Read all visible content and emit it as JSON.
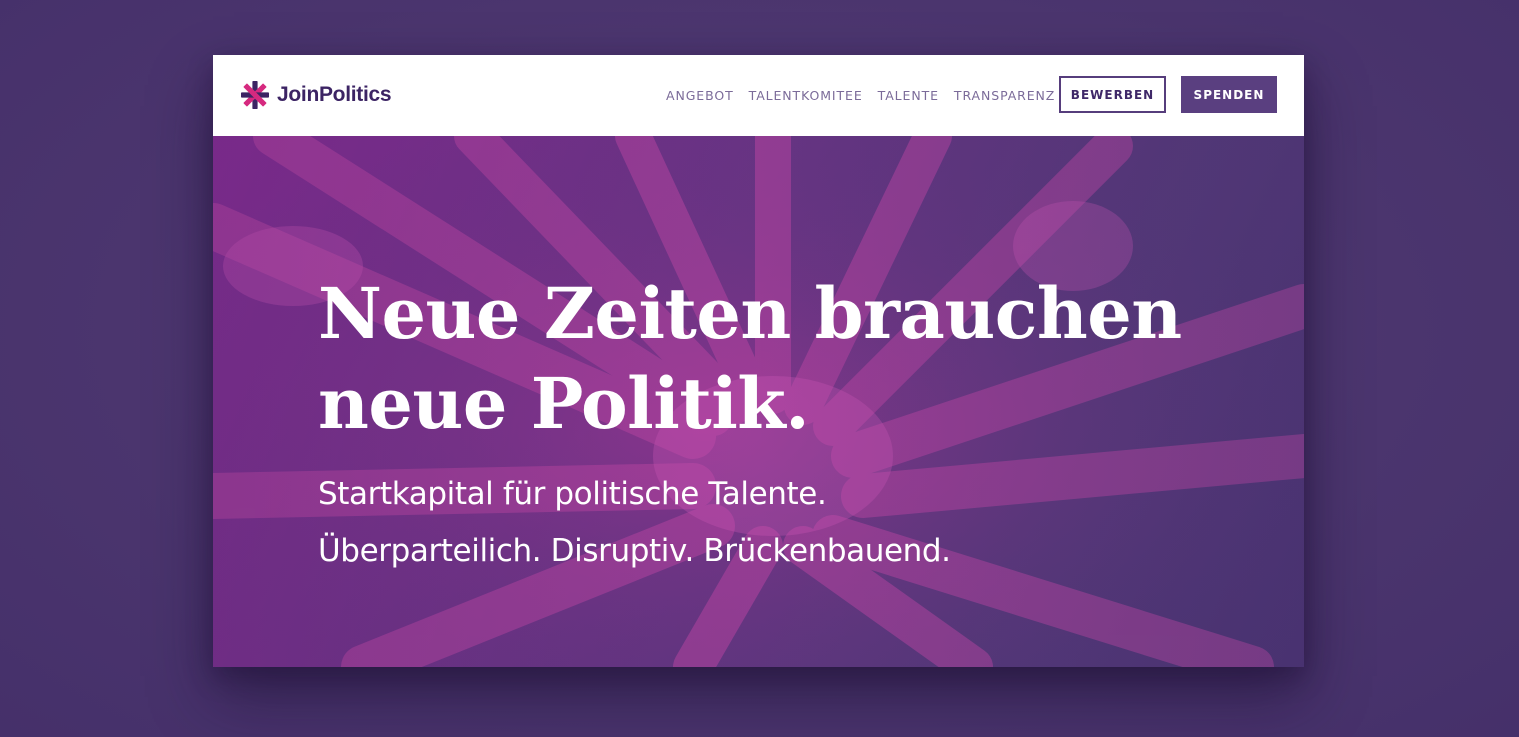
{
  "brand": {
    "name": "JoinPolitics",
    "logo_icon": "asterisk-star-logo",
    "colors": {
      "primary": "#5a3f80",
      "accent": "#d6297f",
      "text_dark": "#3c2464",
      "nav_text": "#7b6b99",
      "background": "#4d3770"
    }
  },
  "nav": {
    "links": [
      {
        "label": "ANGEBOT"
      },
      {
        "label": "TALENTKOMITEE"
      },
      {
        "label": "TALENTE"
      },
      {
        "label": "TRANSPARENZ"
      }
    ],
    "apply_label": "BEWERBEN",
    "donate_label": "SPENDEN"
  },
  "hero": {
    "title_line1": "Neue Zeiten brauchen",
    "title_line2": "neue Politik.",
    "subtitle_line1": "Startkapital für politische Talente.",
    "subtitle_line2": "Überparteilich. Disruptiv. Brückenbauend.",
    "background_image": "stacked-hands-photo"
  }
}
